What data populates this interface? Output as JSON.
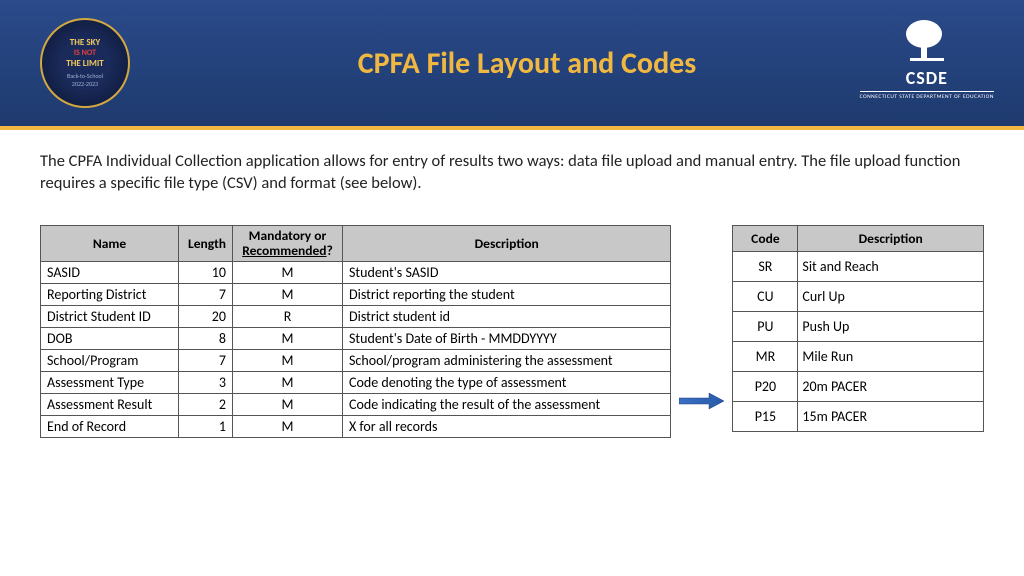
{
  "header": {
    "badge": {
      "line1": "THE SKY",
      "line2": "IS NOT",
      "line3": "THE LIMIT",
      "line4": "Back-to-School",
      "line5": "2022-2023"
    },
    "title": "CPFA File Layout and Codes",
    "logo": {
      "text": "CSDE",
      "sub": "CONNECTICUT STATE\nDEPARTMENT OF EDUCATION"
    }
  },
  "intro": "The CPFA Individual Collection application allows for entry of results two ways: data file upload and manual entry.  The file upload function requires a specific file type (CSV) and format (see below).",
  "table1": {
    "headers": {
      "name": "Name",
      "length": "Length",
      "mr1": "Mandatory or",
      "mr2": "Recommended",
      "mr3": "?",
      "desc": "Description"
    },
    "rows": [
      {
        "name": "SASID",
        "length": "10",
        "mr": "M",
        "desc": "Student's SASID"
      },
      {
        "name": "Reporting District",
        "length": "7",
        "mr": "M",
        "desc": "District reporting the student"
      },
      {
        "name": "District Student ID",
        "length": "20",
        "mr": "R",
        "desc": "District student id"
      },
      {
        "name": "DOB",
        "length": "8",
        "mr": "M",
        "desc": "Student's Date of Birth - MMDDYYYY"
      },
      {
        "name": "School/Program",
        "length": "7",
        "mr": "M",
        "desc": "School/program administering the assessment"
      },
      {
        "name": "Assessment Type",
        "length": "3",
        "mr": "M",
        "desc": "Code denoting the type of assessment"
      },
      {
        "name": "Assessment Result",
        "length": "2",
        "mr": "M",
        "desc": "Code indicating the result of the assessment"
      },
      {
        "name": "End of Record",
        "length": "1",
        "mr": "M",
        "desc": "X for all records"
      }
    ]
  },
  "table2": {
    "headers": {
      "code": "Code",
      "desc": "Description"
    },
    "rows": [
      {
        "code": "SR",
        "desc": "Sit and Reach"
      },
      {
        "code": "CU",
        "desc": "Curl Up"
      },
      {
        "code": "PU",
        "desc": "Push Up"
      },
      {
        "code": "MR",
        "desc": "Mile Run"
      },
      {
        "code": "P20",
        "desc": "20m PACER"
      },
      {
        "code": "P15",
        "desc": "15m PACER"
      }
    ]
  }
}
